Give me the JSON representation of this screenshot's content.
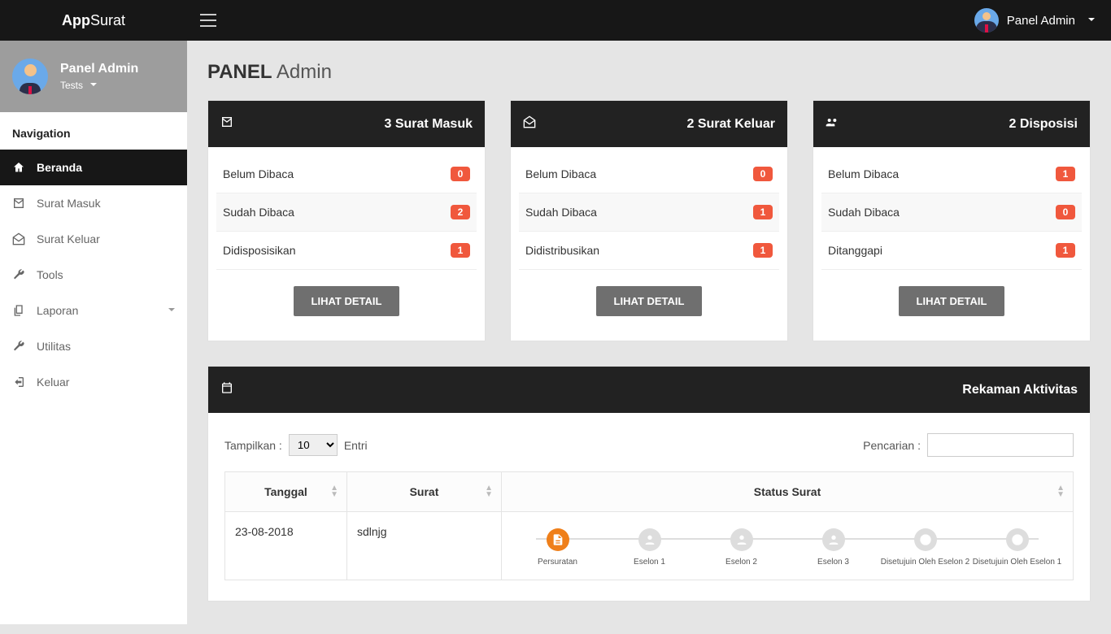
{
  "app": {
    "name_bold": "App",
    "name_rest": " Surat"
  },
  "topbar_user": {
    "name": "Panel Admin"
  },
  "sidebar": {
    "profile_name": "Panel Admin",
    "profile_sub": "Tests",
    "section": "Navigation",
    "items": [
      {
        "label": "Beranda",
        "icon": "home",
        "active": true
      },
      {
        "label": "Surat Masuk",
        "icon": "mail"
      },
      {
        "label": "Surat Keluar",
        "icon": "mail-open"
      },
      {
        "label": "Tools",
        "icon": "wrench"
      },
      {
        "label": "Laporan",
        "icon": "copy",
        "expandable": true
      },
      {
        "label": "Utilitas",
        "icon": "wrench"
      },
      {
        "label": "Keluar",
        "icon": "logout"
      }
    ]
  },
  "page_title": {
    "bold": "PANEL",
    "rest": " Admin"
  },
  "cards": [
    {
      "icon": "mail",
      "title": "3 Surat Masuk",
      "rows": [
        {
          "label": "Belum Dibaca",
          "count": "0"
        },
        {
          "label": "Sudah Dibaca",
          "count": "2"
        },
        {
          "label": "Didisposisikan",
          "count": "1"
        }
      ],
      "button": "LIHAT DETAIL"
    },
    {
      "icon": "mail-open",
      "title": "2 Surat Keluar",
      "rows": [
        {
          "label": "Belum Dibaca",
          "count": "0"
        },
        {
          "label": "Sudah Dibaca",
          "count": "1"
        },
        {
          "label": "Didistribusikan",
          "count": "1"
        }
      ],
      "button": "LIHAT DETAIL"
    },
    {
      "icon": "users",
      "title": "2 Disposisi",
      "rows": [
        {
          "label": "Belum Dibaca",
          "count": "1"
        },
        {
          "label": "Sudah Dibaca",
          "count": "0"
        },
        {
          "label": "Ditanggapi",
          "count": "1"
        }
      ],
      "button": "LIHAT DETAIL"
    }
  ],
  "activity": {
    "title": "Rekaman Aktivitas",
    "show_label_pre": "Tampilkan :",
    "show_value": "10",
    "show_label_post": "Entri",
    "search_label": "Pencarian :",
    "search_value": "",
    "columns": [
      "Tanggal",
      "Surat",
      "Status Surat"
    ],
    "row": {
      "tanggal": "23-08-2018",
      "surat": "sdlnjg",
      "steps": [
        "Persuratan",
        "Eselon 1",
        "Eselon 2",
        "Eselon 3",
        "Disetujuin Oleh Eselon 2",
        "Disetujuin Oleh Eselon 1"
      ],
      "active_step": 0
    }
  }
}
